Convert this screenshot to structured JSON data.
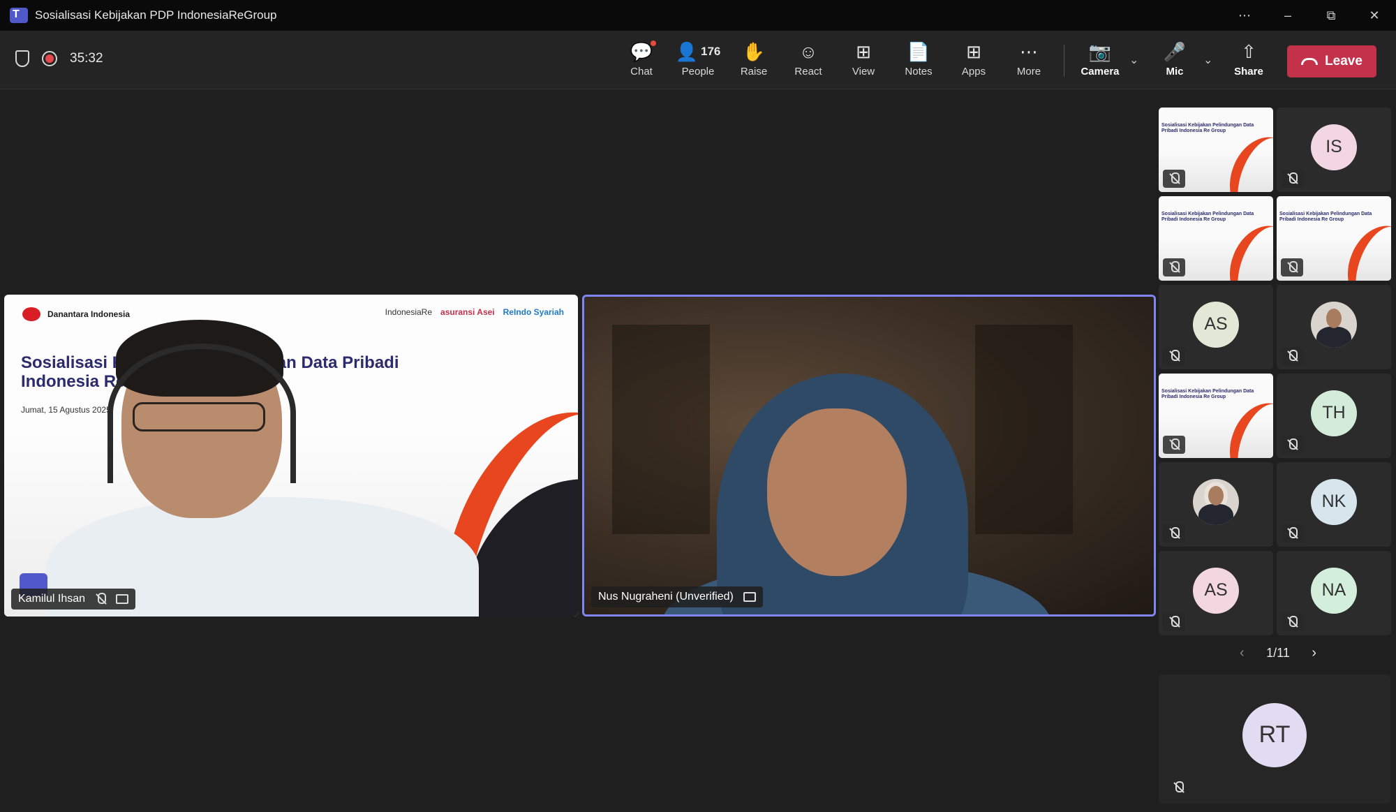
{
  "window": {
    "title": "Sosialisasi Kebijakan PDP IndonesiaReGroup",
    "controls": [
      "⋯",
      "–",
      "⧉",
      "✕"
    ]
  },
  "meeting": {
    "timer": "35:32",
    "buttons": {
      "chat": "Chat",
      "people": "People",
      "people_count": "176",
      "raise": "Raise",
      "react": "React",
      "view": "View",
      "notes": "Notes",
      "apps": "Apps",
      "more": "More",
      "camera": "Camera",
      "mic": "Mic",
      "share": "Share",
      "leave": "Leave"
    },
    "icons": {
      "chat": "💬",
      "people": "👤",
      "raise": "✋",
      "react": "☺",
      "view": "⊞",
      "notes": "📄",
      "apps": "⊞",
      "more": "⋯",
      "camera": "📷",
      "mic": "🎤",
      "share": "⇧",
      "chevron": "⌄"
    }
  },
  "stage": {
    "slide": {
      "logo_left_1": "Danantara Indonesia",
      "logo_right_1": "IndonesiaRe",
      "logo_right_2": "asuransi Asei",
      "logo_right_3": "ReIndo Syariah",
      "title_line1": "Sosialisasi Kebijakan Pelindungan Data Pribadi",
      "title_line2": "Indonesia Re Group",
      "date": "Jumat, 15 Agustus 2025"
    },
    "participants": [
      {
        "name": "Kamilul Ihsan"
      },
      {
        "name": "Nus Nugraheni (Unverified)"
      }
    ]
  },
  "gallery": {
    "slide_thumb_title": "Sosialisasi Kebijakan Pelindungan Data Pribadi Indonesia Re Group",
    "tiles": [
      {
        "type": "slide"
      },
      {
        "type": "initials",
        "initials": "IS",
        "color": "#f2d6e4"
      },
      {
        "type": "slide"
      },
      {
        "type": "slide"
      },
      {
        "type": "initials",
        "initials": "AS",
        "color": "#e3e8d6"
      },
      {
        "type": "photo"
      },
      {
        "type": "slide"
      },
      {
        "type": "initials",
        "initials": "TH",
        "color": "#d3ecd9"
      },
      {
        "type": "photo"
      },
      {
        "type": "initials",
        "initials": "NK",
        "color": "#d6e6ec"
      },
      {
        "type": "initials",
        "initials": "AS",
        "color": "#f2d6e0"
      },
      {
        "type": "initials",
        "initials": "NA",
        "color": "#d3efdc"
      }
    ],
    "pager": "1/11",
    "pinned": {
      "initials": "RT",
      "color": "#e2dcf2"
    }
  }
}
